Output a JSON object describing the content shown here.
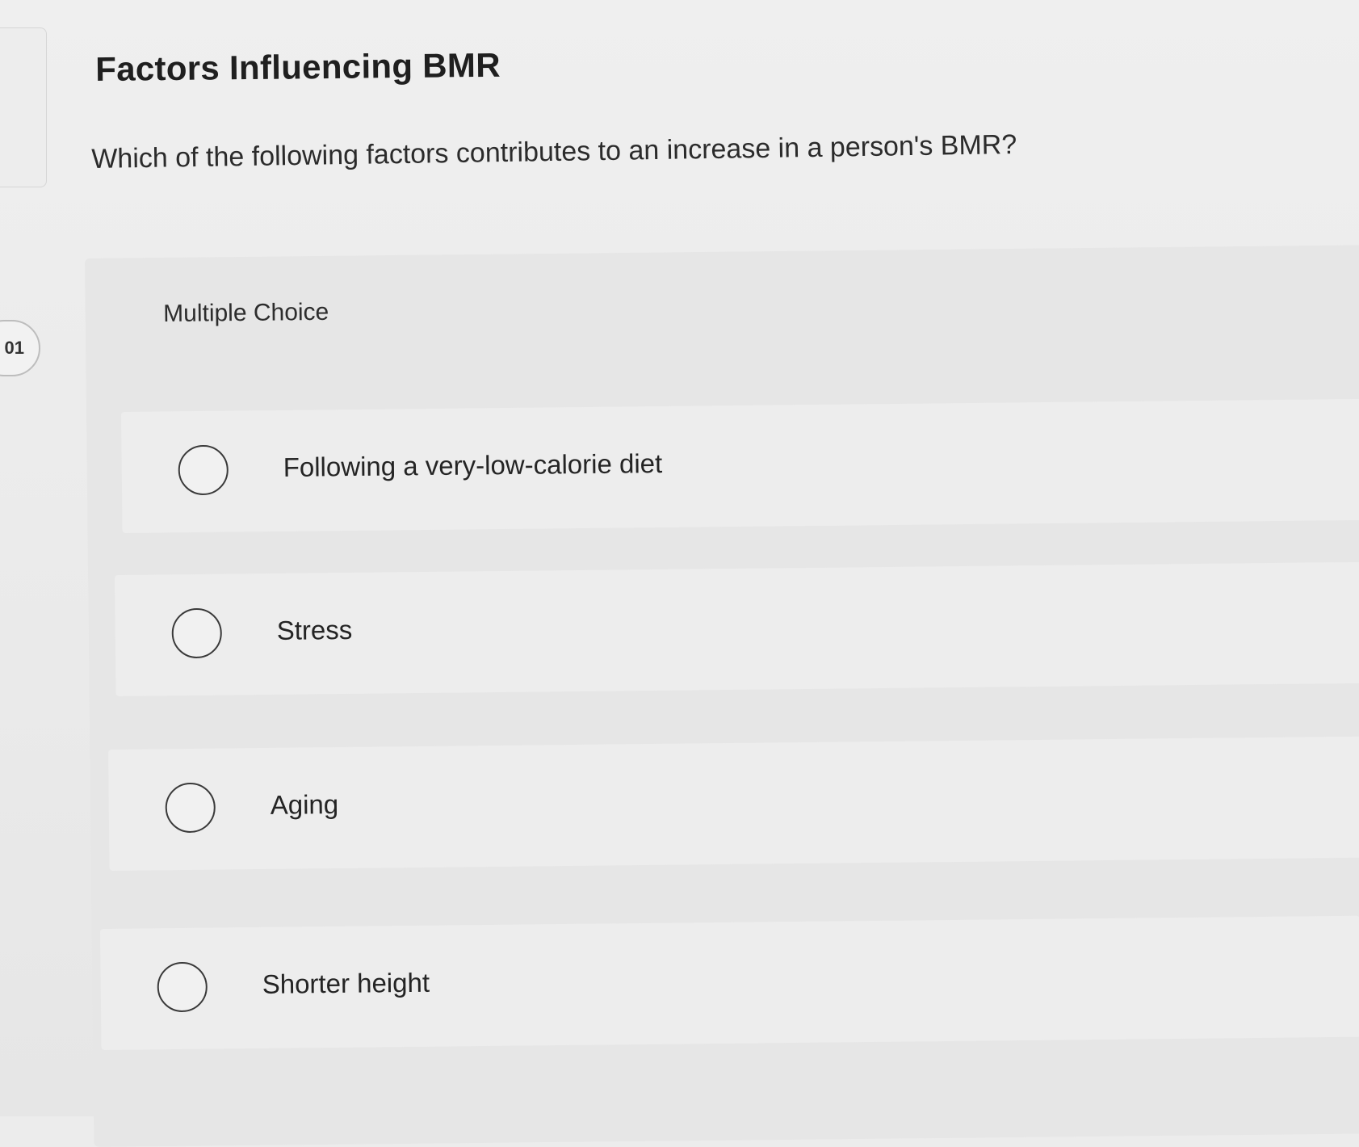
{
  "question": {
    "number_partial": "01",
    "title": "Factors Influencing BMR",
    "prompt": "Which of the following factors contributes to an increase in a person's BMR?",
    "type_label": "Multiple Choice"
  },
  "options": [
    {
      "label": "Following a very-low-calorie diet"
    },
    {
      "label": "Stress"
    },
    {
      "label": "Aging"
    },
    {
      "label": "Shorter height"
    }
  ]
}
